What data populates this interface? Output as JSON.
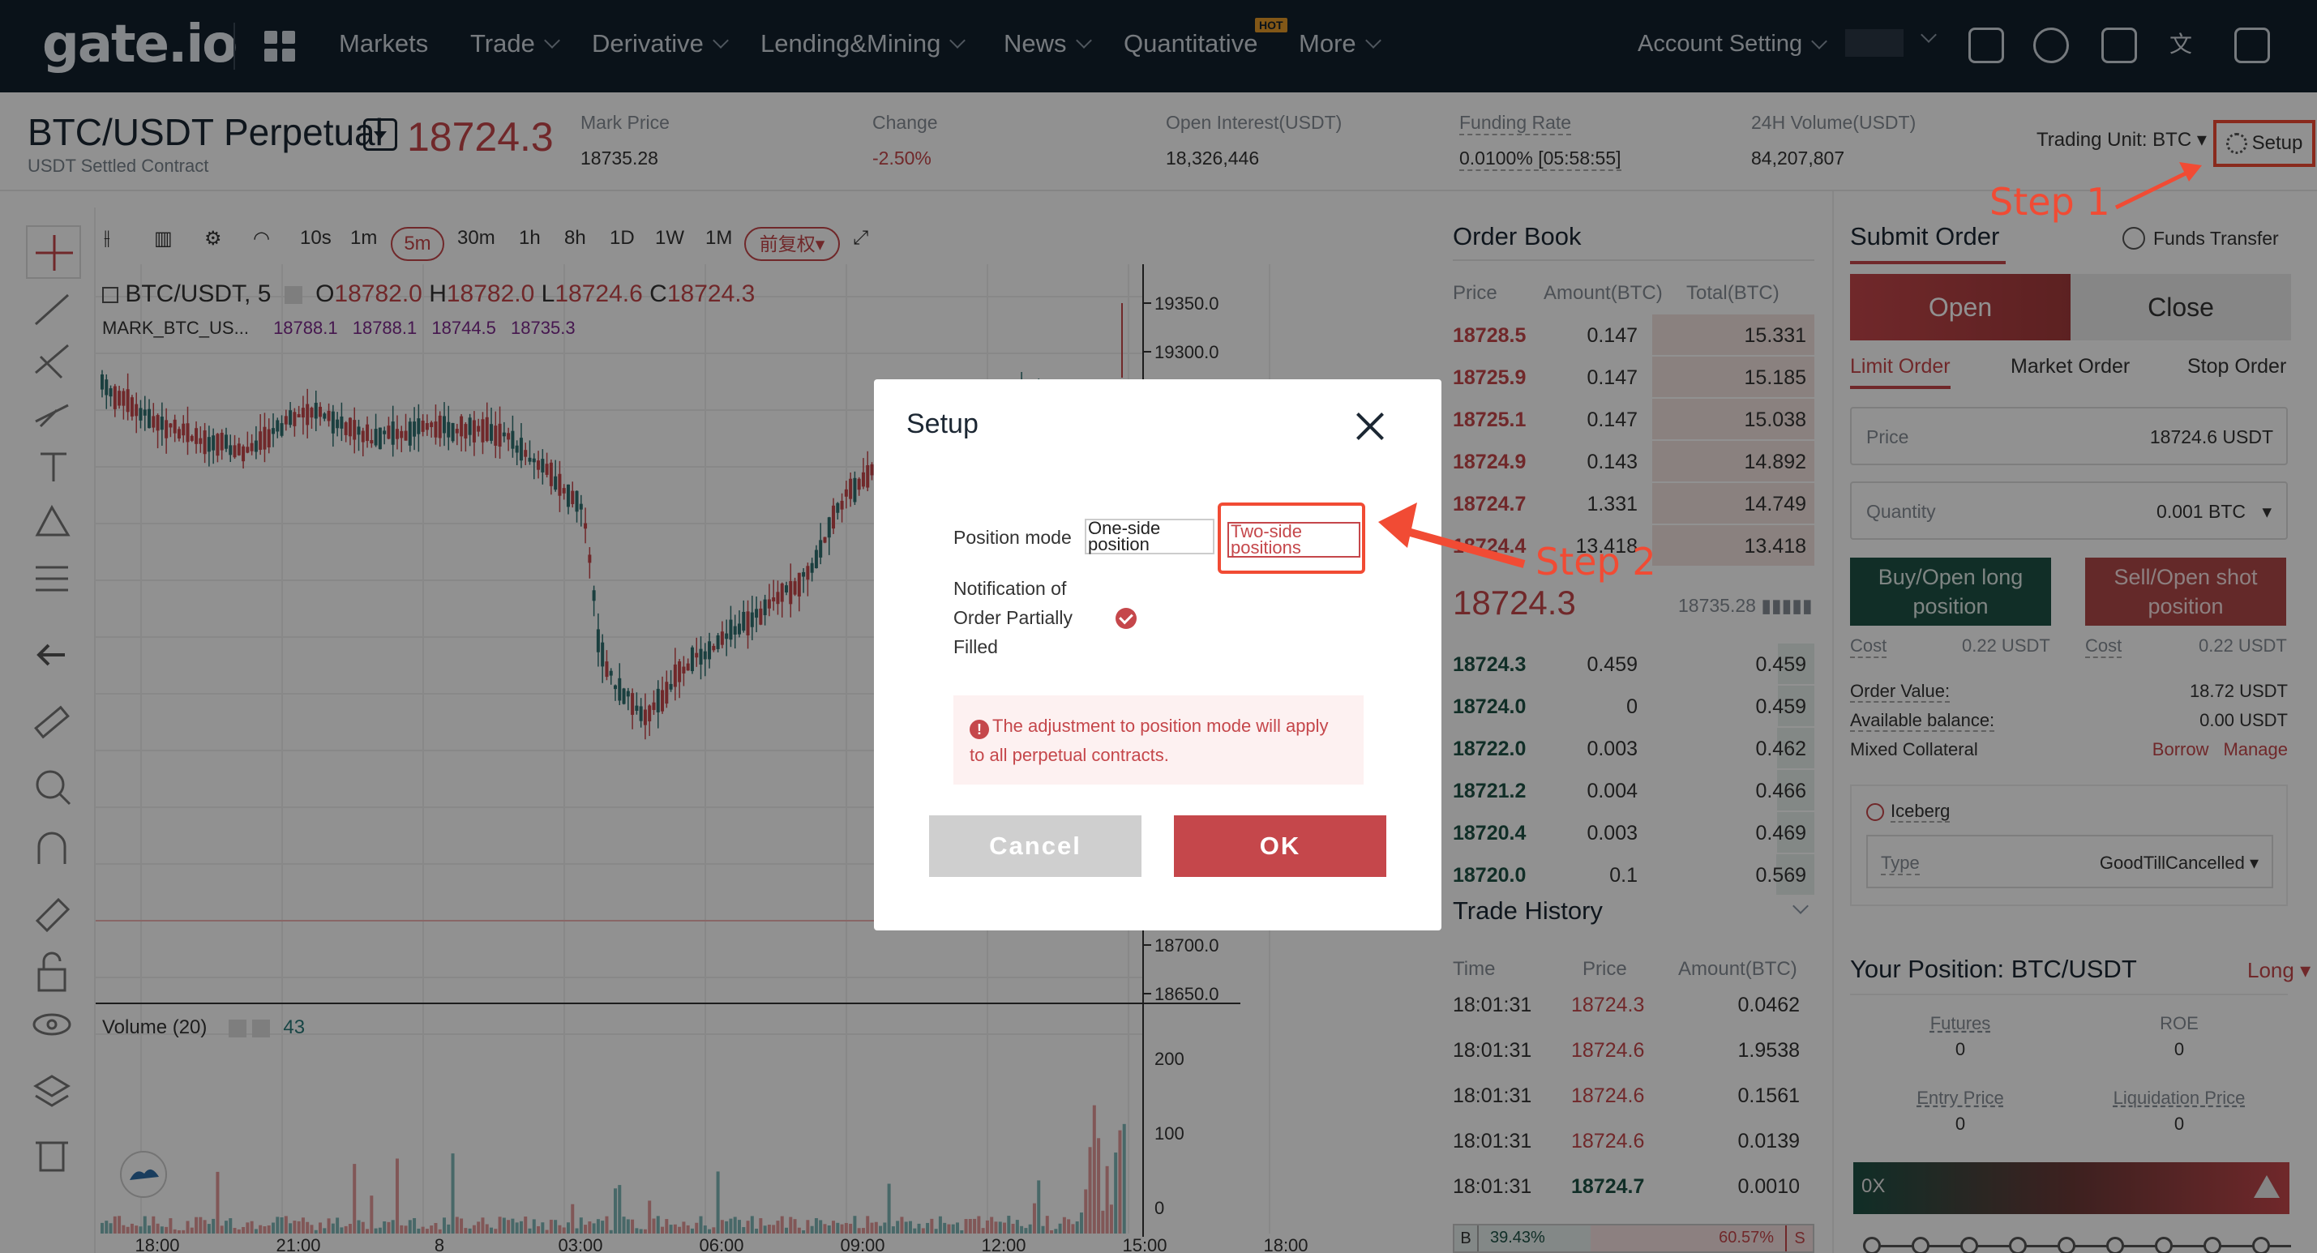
{
  "nav": {
    "logo": "gate.io",
    "items": [
      {
        "label": "Markets",
        "chevron": false
      },
      {
        "label": "Trade",
        "chevron": true
      },
      {
        "label": "Derivative",
        "chevron": true
      },
      {
        "label": "Lending&Mining",
        "chevron": true
      },
      {
        "label": "News",
        "chevron": true
      },
      {
        "label": "Quantitative",
        "chevron": false
      },
      {
        "label": "More",
        "chevron": true
      }
    ],
    "hot_badge": "HOT",
    "account_setting": "Account Setting",
    "icons": [
      "app-download-icon",
      "support-icon",
      "settings-monitor-icon",
      "language-icon",
      "expand-icon"
    ]
  },
  "ticker": {
    "pair": "BTC/USDT Perpetual",
    "price": "18724.3",
    "subtitle": "USDT Settled Contract",
    "stats": [
      {
        "label": "Mark Price",
        "value": "18735.28",
        "value_color": "#333333"
      },
      {
        "label": "Change",
        "value": "-2.50%",
        "value_color": "#c5474b"
      },
      {
        "label": "Open Interest(USDT)",
        "value": "18,326,446",
        "value_color": "#333333"
      },
      {
        "label": "Funding Rate",
        "value": "0.0100% [05:58:55]",
        "value_color": "#333333"
      },
      {
        "label": "24H Volume(USDT)",
        "value": "84,207,807",
        "value_color": "#333333"
      }
    ],
    "trading_unit": "Trading Unit: BTC",
    "setup": "Setup"
  },
  "chart": {
    "timeframes": [
      "10s",
      "1m",
      "5m",
      "30m",
      "1h",
      "8h",
      "1D",
      "1W",
      "1M"
    ],
    "active_timeframe": "5m",
    "adjust_label": "前复权",
    "symbol": "BTC/USDT, 5",
    "ohlc": {
      "o_label": "O",
      "o": "18782.0",
      "h_label": "H",
      "h": "18782.0",
      "l_label": "L",
      "l": "18724.6",
      "c_label": "C",
      "c": "18724.3"
    },
    "mark_label": "MARK_BTC_US...",
    "mark_values": [
      "18788.1",
      "18788.1",
      "18744.5",
      "18735.3"
    ],
    "price_axis": [
      "19350.0",
      "19300.0",
      "18700.0",
      "18650.0"
    ],
    "volume_label": "Volume (20)",
    "volume_value": "43",
    "volume_axis": [
      "200",
      "100",
      "0"
    ],
    "time_axis": [
      "18:00",
      "21:00",
      "8",
      "03:00",
      "06:00",
      "09:00",
      "12:00",
      "15:00",
      "18:00"
    ]
  },
  "order_book": {
    "title": "Order Book",
    "headers": [
      "Price",
      "Amount(BTC)",
      "Total(BTC)"
    ],
    "asks": [
      {
        "price": "18728.5",
        "amount": "0.147",
        "total": "15.331"
      },
      {
        "price": "18725.9",
        "amount": "0.147",
        "total": "15.185"
      },
      {
        "price": "18725.1",
        "amount": "0.147",
        "total": "15.038"
      },
      {
        "price": "18724.9",
        "amount": "0.143",
        "total": "14.892"
      },
      {
        "price": "18724.7",
        "amount": "1.331",
        "total": "14.749"
      },
      {
        "price": "18724.4",
        "amount": "13.418",
        "total": "13.418"
      }
    ],
    "mid_price": "18724.3",
    "mid_mark": "18735.28",
    "bids": [
      {
        "price": "18724.3",
        "amount": "0.459",
        "total": "0.459"
      },
      {
        "price": "18724.0",
        "amount": "0",
        "total": "0.459"
      },
      {
        "price": "18722.0",
        "amount": "0.003",
        "total": "0.462"
      },
      {
        "price": "18721.2",
        "amount": "0.004",
        "total": "0.466"
      },
      {
        "price": "18720.4",
        "amount": "0.003",
        "total": "0.469"
      },
      {
        "price": "18720.0",
        "amount": "0.1",
        "total": "0.569"
      }
    ]
  },
  "trade_history": {
    "title": "Trade History",
    "headers": [
      "Time",
      "Price",
      "Amount(BTC)"
    ],
    "rows": [
      {
        "time": "18:01:31",
        "price": "18724.3",
        "amount": "0.0462",
        "side": "sell"
      },
      {
        "time": "18:01:31",
        "price": "18724.6",
        "amount": "1.9538",
        "side": "sell"
      },
      {
        "time": "18:01:31",
        "price": "18724.6",
        "amount": "0.1561",
        "side": "sell"
      },
      {
        "time": "18:01:31",
        "price": "18724.6",
        "amount": "0.0139",
        "side": "sell"
      },
      {
        "time": "18:01:31",
        "price": "18724.7",
        "amount": "0.0010",
        "side": "buy"
      }
    ],
    "buy_label": "B",
    "buy_pct": "39.43%",
    "sell_pct": "60.57%",
    "sell_label": "S"
  },
  "submit_order": {
    "title": "Submit Order",
    "funds_transfer": "Funds Transfer",
    "open": "Open",
    "close": "Close",
    "order_types": [
      "Limit Order",
      "Market Order",
      "Stop Order"
    ],
    "price_label": "Price",
    "price_value": "18724.6 USDT",
    "qty_label": "Quantity",
    "qty_value": "0.001  BTC",
    "buy_btn": "Buy/Open long position",
    "sell_btn": "Sell/Open shot position",
    "cost_label": "Cost",
    "buy_cost": "0.22 USDT",
    "sell_cost": "0.22 USDT",
    "order_value_label": "Order Value:",
    "order_value": "18.72 USDT",
    "avail_label": "Available balance:",
    "avail_value": "0.00 USDT",
    "mixed_label": "Mixed Collateral",
    "borrow": "Borrow",
    "manage": "Manage",
    "iceberg": "Iceberg",
    "type_label": "Type",
    "type_value": "GoodTillCancelled"
  },
  "position": {
    "title": "Your Position: BTC/USDT",
    "side": "Long",
    "futures_label": "Futures",
    "futures_value": "0",
    "roe_label": "ROE",
    "roe_value": "0",
    "entry_label": "Entry Price",
    "entry_value": "0",
    "liq_label": "Liquidation Price",
    "liq_value": "0",
    "leverage": "0X"
  },
  "modal": {
    "title": "Setup",
    "position_mode_label": "Position mode",
    "one_side": "One-side position",
    "two_side": "Two-side positions",
    "notification_label": "Notification of Order Partially Filled",
    "notification_checked": true,
    "warning": "The adjustment to position mode will apply to all perpetual contracts.",
    "cancel": "Cancel",
    "ok": "OK"
  },
  "annotations": {
    "step1": "Step 1",
    "step2": "Step 2",
    "color": "#f14b34"
  }
}
